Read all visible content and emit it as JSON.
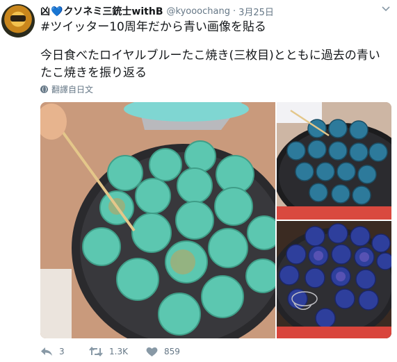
{
  "tweet": {
    "display_name_prefix": "凶",
    "display_name_suffix": "クソネミ三銃士withB",
    "handle": "@kyooochang",
    "separator": "·",
    "date": "3月25日",
    "text_line1": "#ツイッター10周年だから青い画像を貼る",
    "text_line2": "今日食べたロイヤルブルーたこ焼き(三枚目)とともに過去の青いたこ焼きを振り返る",
    "translate_label": "翻譯自日文"
  },
  "actions": {
    "reply_count": "3",
    "retweet_count": "1.3K",
    "like_count": "859"
  },
  "icons": {
    "heart_emoji": "heart-icon",
    "caret": "chevron-down-icon",
    "translate": "globe-icon",
    "reply": "reply-icon",
    "retweet": "retweet-icon",
    "like": "like-icon"
  },
  "colors": {
    "text": "#14171a",
    "secondary": "#657786",
    "link_blue": "#1da1f2"
  }
}
